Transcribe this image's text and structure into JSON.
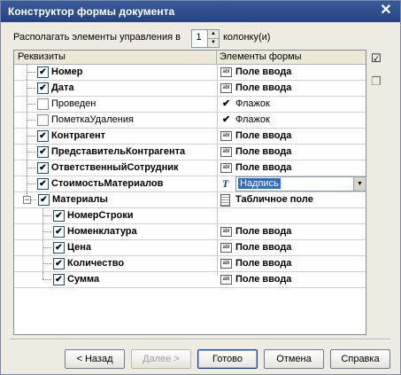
{
  "window": {
    "title": "Конструктор формы документа"
  },
  "arrange": {
    "prefix": "Располагать элементы управления в",
    "value": "1",
    "suffix": "колонку(и)"
  },
  "grid": {
    "columns": [
      "Реквизиты",
      "Элементы формы"
    ],
    "rows": [
      {
        "label": "Номер",
        "checked": true,
        "bold": true,
        "element": "Поле ввода",
        "icon": "text-field-icon"
      },
      {
        "label": "Дата",
        "checked": true,
        "bold": true,
        "element": "Поле ввода",
        "icon": "text-field-icon"
      },
      {
        "label": "Проведен",
        "checked": false,
        "bold": false,
        "element": "Флажок",
        "icon": "checkbox-icon"
      },
      {
        "label": "ПометкаУдаления",
        "checked": false,
        "bold": false,
        "element": "Флажок",
        "icon": "checkbox-icon"
      },
      {
        "label": "Контрагент",
        "checked": true,
        "bold": true,
        "element": "Поле ввода",
        "icon": "text-field-icon"
      },
      {
        "label": "ПредставительКонтрагента",
        "checked": true,
        "bold": true,
        "element": "Поле ввода",
        "icon": "text-field-icon"
      },
      {
        "label": "ОтветственныйСотрудник",
        "checked": true,
        "bold": true,
        "element": "Поле ввода",
        "icon": "text-field-icon"
      },
      {
        "label": "СтоимостьМатериалов",
        "checked": true,
        "bold": true,
        "element": "Надпись",
        "icon": "label-icon"
      },
      {
        "label": "Материалы",
        "checked": true,
        "bold": true,
        "element": "Табличное поле",
        "icon": "table-icon"
      },
      {
        "label": "НомерСтроки",
        "checked": true,
        "bold": true,
        "element": "",
        "icon": ""
      },
      {
        "label": "Номенклатура",
        "checked": true,
        "bold": true,
        "element": "Поле ввода",
        "icon": "text-field-icon"
      },
      {
        "label": "Цена",
        "checked": true,
        "bold": true,
        "element": "Поле ввода",
        "icon": "text-field-icon"
      },
      {
        "label": "Количество",
        "checked": true,
        "bold": true,
        "element": "Поле ввода",
        "icon": "text-field-icon"
      },
      {
        "label": "Сумма",
        "checked": true,
        "bold": true,
        "element": "Поле ввода",
        "icon": "text-field-icon"
      }
    ],
    "text_field_icon_text": "abl",
    "check_mark": "✔",
    "label_icon_text": "T",
    "expander_text": "−"
  },
  "buttons": {
    "back": "< Назад",
    "next": "Далее >",
    "done": "Готово",
    "cancel": "Отмена",
    "help": "Справка"
  },
  "colors": {
    "title_bar": "#2c4d8e",
    "selection": "#316ac5",
    "dialog_bg": "#eeebe3"
  }
}
